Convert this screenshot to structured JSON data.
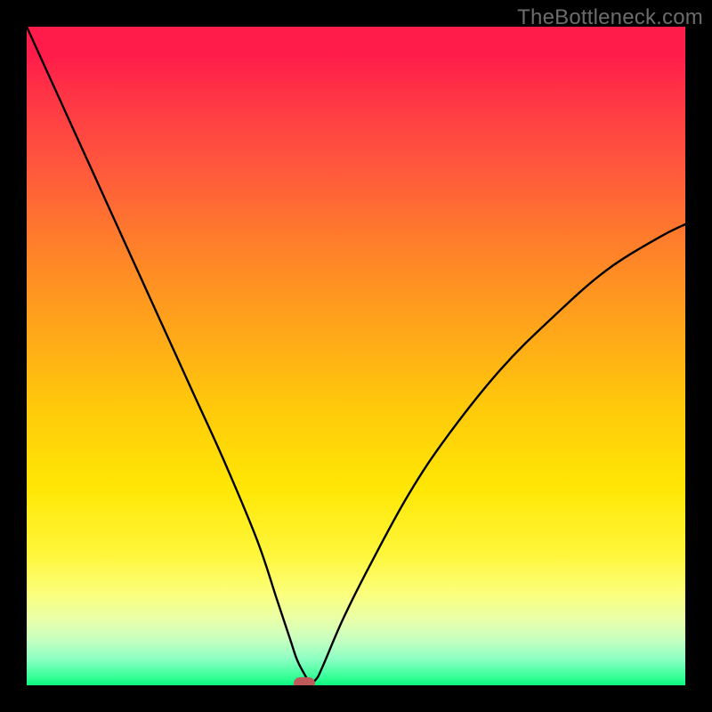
{
  "watermark": "TheBottleneck.com",
  "chart_data": {
    "type": "line",
    "title": "",
    "xlabel": "",
    "ylabel": "",
    "xlim": [
      0,
      100
    ],
    "ylim": [
      0,
      100
    ],
    "grid": false,
    "legend": false,
    "series": [
      {
        "name": "bottleneck-curve",
        "x": [
          0,
          5,
          10,
          15,
          20,
          25,
          30,
          35,
          38,
          40,
          41,
          42,
          43,
          44,
          45,
          48,
          52,
          58,
          64,
          72,
          80,
          88,
          96,
          100
        ],
        "y": [
          100,
          89,
          78,
          67,
          56,
          45,
          34,
          22,
          13,
          7,
          4,
          2,
          0.5,
          1,
          3,
          10,
          18,
          29,
          38,
          48,
          56,
          63,
          68,
          70
        ]
      }
    ],
    "marker": {
      "x": 42.2,
      "y": 0.3
    },
    "gradient": {
      "direction": "top-to-bottom",
      "stops": [
        {
          "pos": 0,
          "color": "#ff1b4a"
        },
        {
          "pos": 50,
          "color": "#ffca0a"
        },
        {
          "pos": 85,
          "color": "#fbff7a"
        },
        {
          "pos": 100,
          "color": "#0cf57f"
        }
      ]
    }
  }
}
